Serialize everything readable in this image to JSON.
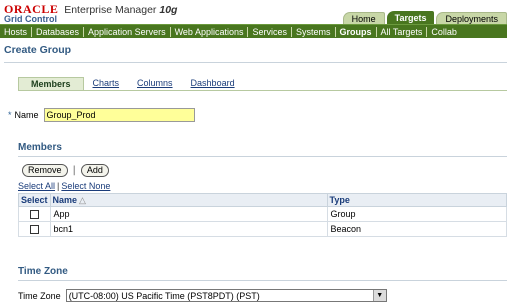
{
  "header": {
    "brand": "ORACLE",
    "product": "Enterprise Manager",
    "version": "10g",
    "subtitle": "Grid Control",
    "tabs": [
      {
        "label": "Home",
        "active": false
      },
      {
        "label": "Targets",
        "active": true
      },
      {
        "label": "Deployments",
        "active": false
      }
    ]
  },
  "nav": {
    "items": [
      {
        "label": "Hosts",
        "active": false
      },
      {
        "label": "Databases",
        "active": false
      },
      {
        "label": "Application Servers",
        "active": false
      },
      {
        "label": "Web Applications",
        "active": false
      },
      {
        "label": "Services",
        "active": false
      },
      {
        "label": "Systems",
        "active": false
      },
      {
        "label": "Groups",
        "active": true
      },
      {
        "label": "All Targets",
        "active": false
      },
      {
        "label": "Collab",
        "active": false
      }
    ]
  },
  "page": {
    "title": "Create Group"
  },
  "subtabs": [
    {
      "label": "Members",
      "active": true
    },
    {
      "label": "Charts",
      "active": false
    },
    {
      "label": "Columns",
      "active": false
    },
    {
      "label": "Dashboard",
      "active": false
    }
  ],
  "form": {
    "required_mark": "*",
    "name_label": "Name",
    "name_value": "Group_Prod"
  },
  "members": {
    "title": "Members",
    "remove_label": "Remove",
    "add_label": "Add",
    "separator": "|",
    "select_all": "Select All",
    "select_none": "Select None",
    "columns": {
      "select": "Select",
      "name": "Name",
      "type": "Type"
    },
    "rows": [
      {
        "name": "App",
        "type": "Group"
      },
      {
        "name": "bcn1",
        "type": "Beacon"
      }
    ]
  },
  "timezone": {
    "title": "Time Zone",
    "label": "Time Zone",
    "selected": "(UTC-08:00) US Pacific Time (PST8PDT) (PST)"
  }
}
